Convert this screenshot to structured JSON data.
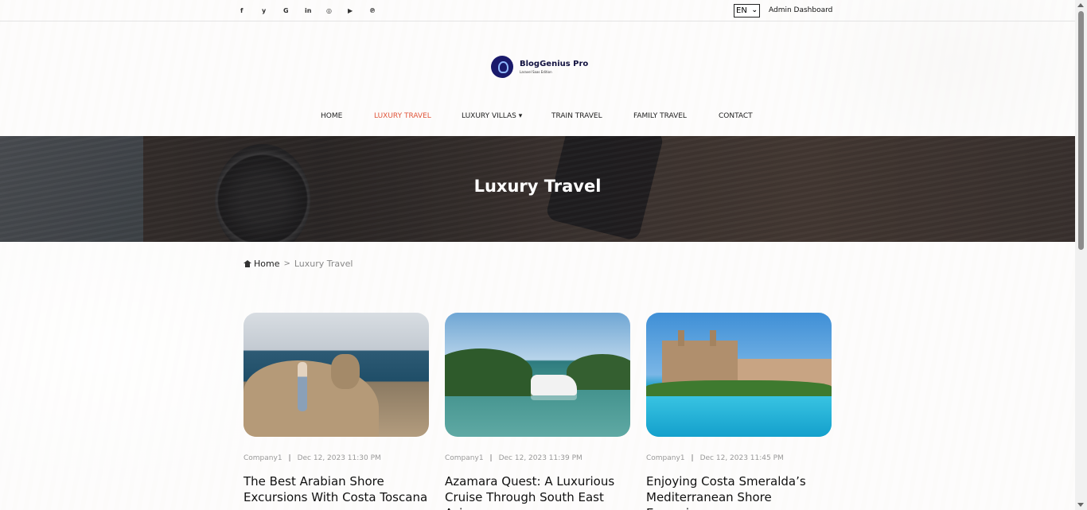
{
  "topbar": {
    "social_icons": [
      {
        "name": "facebook-icon",
        "glyph": "f"
      },
      {
        "name": "twitter-icon",
        "glyph": "y"
      },
      {
        "name": "google-icon",
        "glyph": "G"
      },
      {
        "name": "linkedin-icon",
        "glyph": "in"
      },
      {
        "name": "instagram-icon",
        "glyph": "◎"
      },
      {
        "name": "youtube-icon",
        "glyph": "▶"
      },
      {
        "name": "pinterest-icon",
        "glyph": "℗"
      }
    ],
    "language": "EN",
    "admin_link": "Admin Dashboard"
  },
  "logo": {
    "name": "BlogGenius Pro",
    "subtitle": "Laravel Saas Edition"
  },
  "nav": {
    "items": [
      {
        "label": "HOME",
        "active": false
      },
      {
        "label": "LUXURY TRAVEL",
        "active": true
      },
      {
        "label": "LUXURY VILLAS ▾",
        "active": false
      },
      {
        "label": "TRAIN TRAVEL",
        "active": false
      },
      {
        "label": "FAMILY TRAVEL",
        "active": false
      },
      {
        "label": "CONTACT",
        "active": false
      }
    ]
  },
  "hero": {
    "title": "Luxury Travel"
  },
  "breadcrumb": {
    "home": "Home",
    "separator": ">",
    "current": "Luxury Travel"
  },
  "posts": [
    {
      "author": "Company1",
      "date": "Dec 12, 2023 11:30 PM",
      "title": "The Best Arabian Shore Excursions With Costa Toscana"
    },
    {
      "author": "Company1",
      "date": "Dec 12, 2023 11:39 PM",
      "title": "Azamara Quest: A Luxurious Cruise Through South East Asia"
    },
    {
      "author": "Company1",
      "date": "Dec 12, 2023 11:45 PM",
      "title": "Enjoying Costa Smeralda’s Mediterranean Shore Excursions"
    }
  ],
  "colors": {
    "accent": "#e0553a",
    "text": "#222222",
    "meta": "#999999"
  }
}
